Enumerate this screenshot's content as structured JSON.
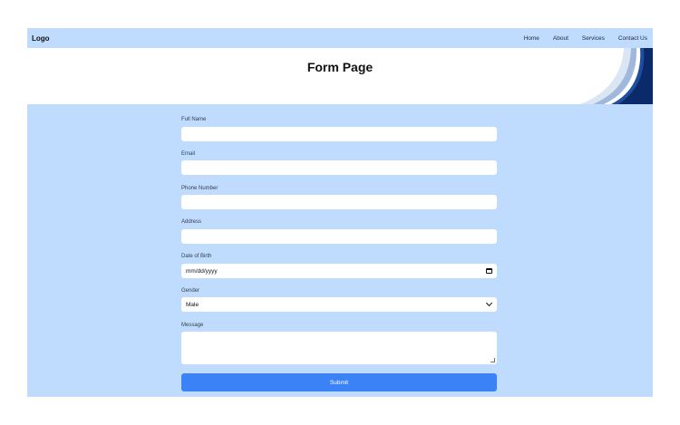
{
  "navbar": {
    "logo": "Logo",
    "links": [
      "Home",
      "About",
      "Services",
      "Contact Us"
    ]
  },
  "hero": {
    "title": "Form Page"
  },
  "form": {
    "full_name": {
      "label": "Full Name",
      "value": ""
    },
    "email": {
      "label": "Email",
      "value": ""
    },
    "phone": {
      "label": "Phone Number",
      "value": ""
    },
    "address": {
      "label": "Address",
      "value": ""
    },
    "dob": {
      "label": "Date of Birth",
      "placeholder": "mm/dd/yyyy"
    },
    "gender": {
      "label": "Gender",
      "selected": "Male"
    },
    "message": {
      "label": "Message",
      "value": ""
    },
    "submit_label": "Submit"
  },
  "colors": {
    "nav_bg": "#bfdbfe",
    "form_bg": "#bfdbfe",
    "submit_bg": "#3b82f6",
    "wave_dark": "#0b2a6b"
  },
  "icons": {
    "date": "calendar-icon",
    "select": "chevron-down-icon",
    "textarea": "resize-handle-icon"
  }
}
